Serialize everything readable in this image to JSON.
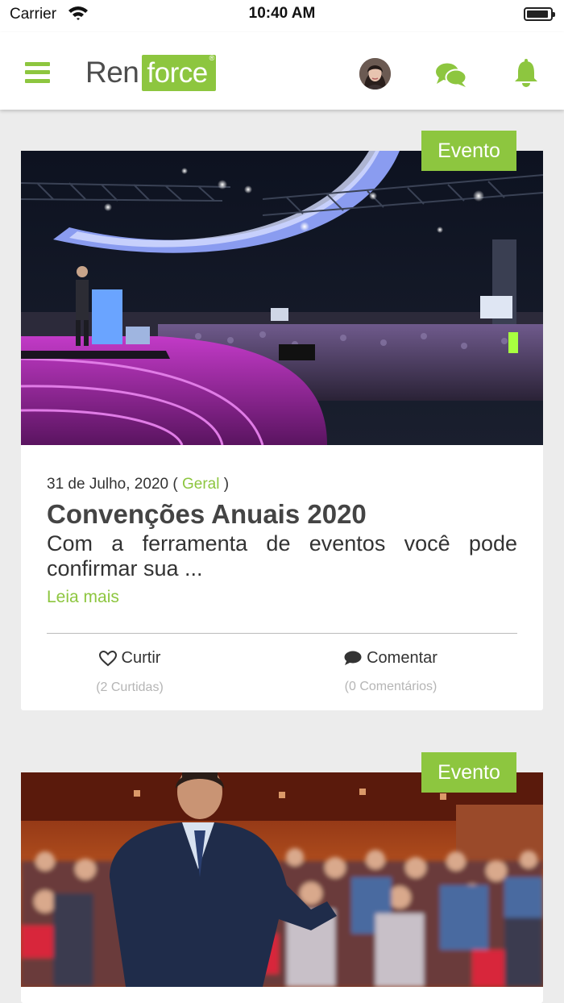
{
  "status_bar": {
    "carrier": "Carrier",
    "time": "10:40 AM"
  },
  "header": {
    "logo_left": "Ren",
    "logo_right": "force",
    "logo_mark": "®",
    "icons": [
      "menu-icon",
      "avatar",
      "chat-icon",
      "bell-icon"
    ],
    "accent_color": "#8dc63f"
  },
  "posts": [
    {
      "badge": "Evento",
      "image": "conference-stage-photo",
      "date": "31 de Julho, 2020",
      "paren_open": " ( ",
      "category": "Geral",
      "paren_close": " )",
      "title": "Convenções Anuais 2020",
      "excerpt": "Com a ferramenta de eventos você pode confirmar sua ...",
      "read_more": "Leia mais",
      "like_label": "Curtir",
      "like_count": "(2 Curtidas)",
      "comment_label": "Comentar",
      "comment_count": "(0 Comentários)"
    },
    {
      "badge": "Evento",
      "image": "speaker-audience-photo"
    }
  ]
}
